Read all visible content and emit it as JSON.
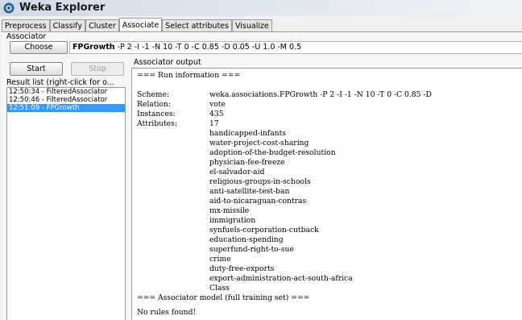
{
  "window": {
    "title": "Weka Explorer"
  },
  "tabs": [
    "Preprocess",
    "Classify",
    "Cluster",
    "Associate",
    "Select attributes",
    "Visualize"
  ],
  "associator": {
    "section_label": "Associator",
    "choose_label": "Choose",
    "algorithm": "FPGrowth",
    "options": "-P 2 -I -1 -N 10 -T 0 -C 0.85 -D 0.05 -U 1.0 -M 0.5"
  },
  "controls": {
    "start_label": "Start",
    "stop_label": "Stop"
  },
  "result_list": {
    "label": "Result list (right-click for o...",
    "items": [
      "12:50:34 - FilteredAssociator",
      "12:50:46 - FilteredAssociator",
      "12:51:09 - FPGrowth"
    ],
    "selected_index": 2
  },
  "output": {
    "label": "Associator output",
    "run_info_header": "=== Run information ===",
    "scheme_key": "Scheme:",
    "scheme_value": "weka.associations.FPGrowth -P 2 -I -1 -N 10 -T 0 -C 0.85 -D",
    "relation_key": "Relation:",
    "relation_value": "vote",
    "instances_key": "Instances:",
    "instances_value": "435",
    "attributes_key": "Attributes:",
    "attributes_value": "17",
    "attributes": [
      "handicapped-infants",
      "water-project-cost-sharing",
      "adoption-of-the-budget-resolution",
      "physician-fee-freeze",
      "el-salvador-aid",
      "religious-groups-in-schools",
      "anti-satellite-test-ban",
      "aid-to-nicaraguan-contras",
      "mx-missile",
      "immigration",
      "synfuels-corporation-cutback",
      "education-spending",
      "superfund-right-to-sue",
      "crime",
      "duty-free-exports",
      "export-administration-act-south-africa",
      "Class"
    ],
    "model_header": "=== Associator model (full training set) ===",
    "result_message": "No rules found!"
  }
}
